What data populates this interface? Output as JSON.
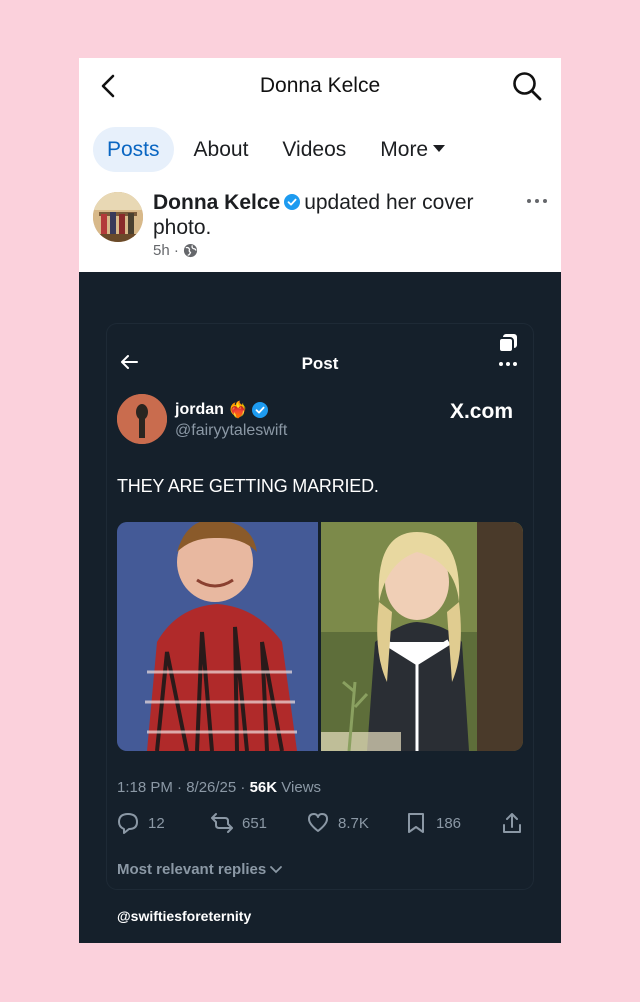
{
  "header": {
    "title": "Donna Kelce"
  },
  "tabs": [
    {
      "label": "Posts",
      "active": true
    },
    {
      "label": "About"
    },
    {
      "label": "Videos"
    },
    {
      "label": "More"
    }
  ],
  "post": {
    "author": "Donna Kelce",
    "action": "updated her cover photo.",
    "time": "5h",
    "separator": "·"
  },
  "tweet": {
    "screen_title": "Post",
    "name": "jordan",
    "name_emoji": "❤️‍🔥",
    "handle": "@fairyytaleswift",
    "site": "X.com",
    "text": "THEY ARE GETTING MARRIED.",
    "timestamp": "1:18 PM · 8/26/25 · ",
    "views_count": "56K",
    "views_label": "Views",
    "stats": {
      "replies": "12",
      "reposts": "651",
      "likes": "8.7K",
      "bookmarks": "186"
    },
    "replies_filter": "Most relevant replies"
  },
  "watermark": "@swiftiesforeternity",
  "colors": {
    "accent": "#0a66c2",
    "verified": "#1d9bf0",
    "dark_bg": "#15202b",
    "muted": "#8b98a5"
  }
}
